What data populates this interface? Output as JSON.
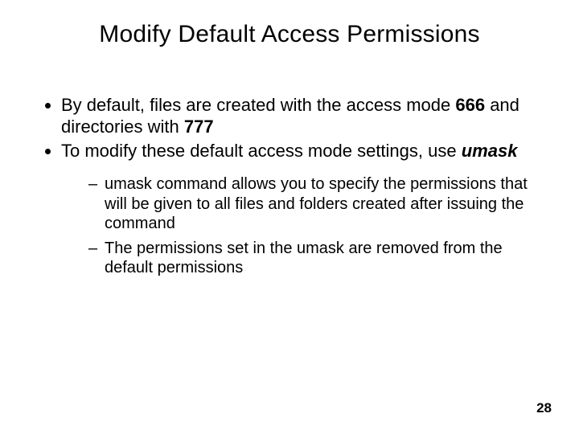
{
  "title": "Modify Default Access Permissions",
  "l1": {
    "item0": {
      "pre": "By default, files are created with the access mode ",
      "mode1": "666",
      "mid": " and directories with ",
      "mode2": "777"
    },
    "item1": {
      "pre": "To modify these default access mode settings, use ",
      "cmd": "umask"
    }
  },
  "l2": {
    "item0": "umask command allows you to specify the permissions that will be given to all files and folders created after issuing the command",
    "item1": "The permissions set in the umask are removed from the default permissions"
  },
  "page": "28"
}
